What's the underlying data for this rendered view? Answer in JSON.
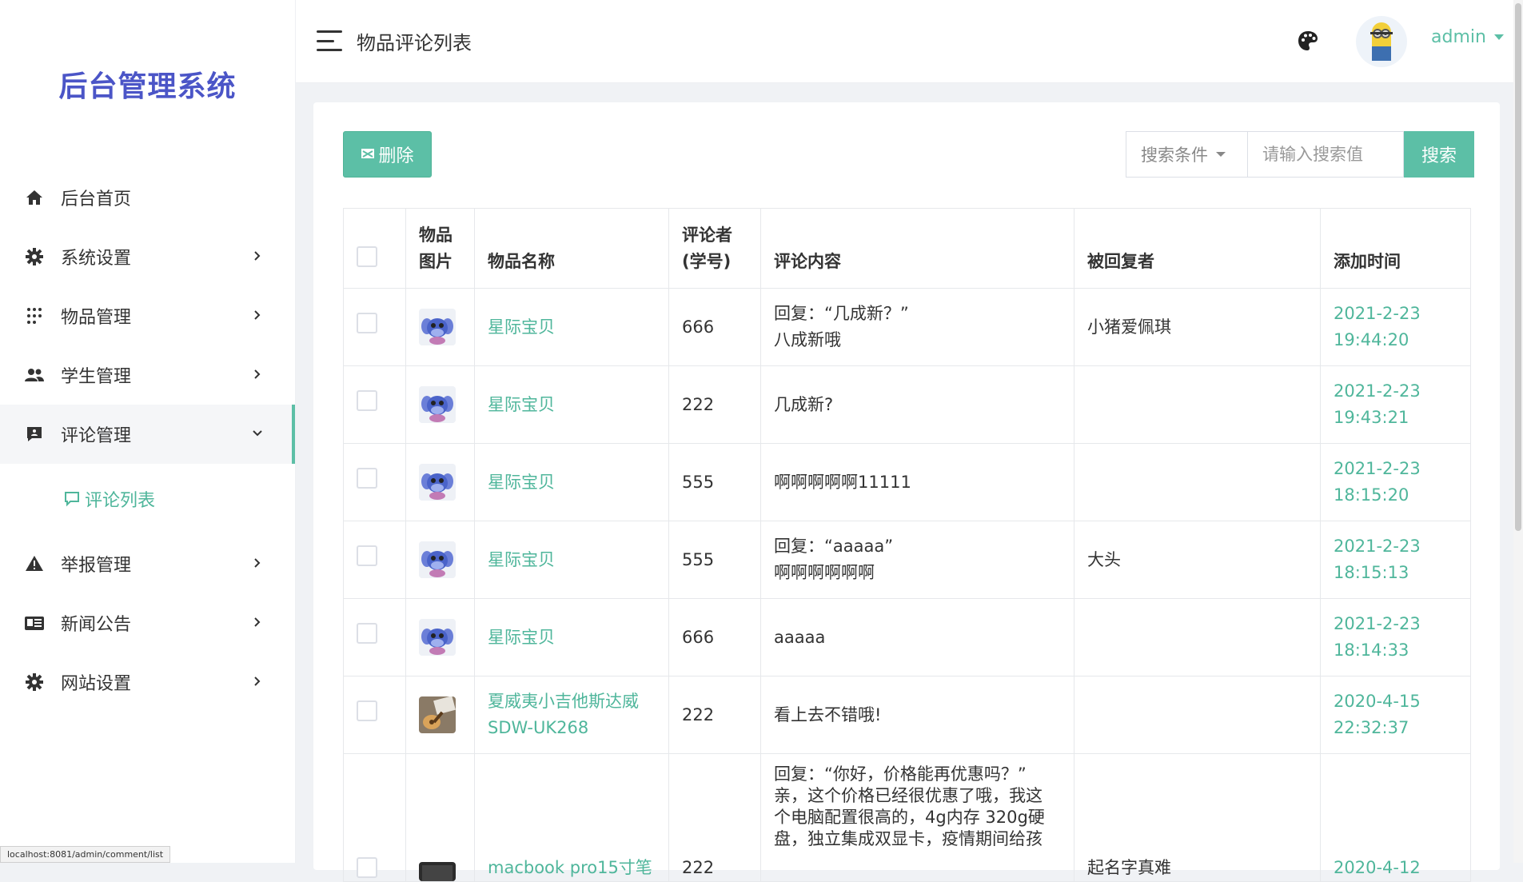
{
  "sidebar": {
    "logo": "后台管理系统",
    "items": [
      {
        "label": "后台首页",
        "icon": "home-icon"
      },
      {
        "label": "系统设置",
        "icon": "gear-icon"
      },
      {
        "label": "物品管理",
        "icon": "grid-dots-icon"
      },
      {
        "label": "学生管理",
        "icon": "users-icon"
      },
      {
        "label": "评论管理",
        "icon": "comment-icon"
      },
      {
        "label": "举报管理",
        "icon": "warning-icon"
      },
      {
        "label": "新闻公告",
        "icon": "news-icon"
      },
      {
        "label": "网站设置",
        "icon": "gear-icon"
      }
    ],
    "submenu": {
      "label": "评论列表",
      "icon": "chat-icon"
    }
  },
  "header": {
    "title": "物品评论列表",
    "username": "admin"
  },
  "toolbar": {
    "delete_label": "删除",
    "search_condition": "搜索条件",
    "search_placeholder": "请输入搜索值",
    "search_button": "搜索"
  },
  "table": {
    "headers": {
      "image_l1": "物品",
      "image_l2": "图片",
      "name": "物品名称",
      "commenter_l1": "评论者",
      "commenter_l2": "(学号)",
      "content": "评论内容",
      "replied": "被回复者",
      "time": "添加时间"
    },
    "rows": [
      {
        "name": "星际宝贝",
        "id": "666",
        "content_l1": "回复：“几成新？”",
        "content_l2": "八成新哦",
        "replied": "小猪爱佩琪",
        "date": "2021-2-23",
        "time": "19:44:20",
        "image": "stitch-toy"
      },
      {
        "name": "星际宝贝",
        "id": "222",
        "content_l1": "几成新?",
        "content_l2": "",
        "replied": "",
        "date": "2021-2-23",
        "time": "19:43:21",
        "image": "stitch-toy"
      },
      {
        "name": "星际宝贝",
        "id": "555",
        "content_l1": "啊啊啊啊啊11111",
        "content_l2": "",
        "replied": "",
        "date": "2021-2-23",
        "time": "18:15:20",
        "image": "stitch-toy"
      },
      {
        "name": "星际宝贝",
        "id": "555",
        "content_l1": "回复：“aaaaa”",
        "content_l2": "啊啊啊啊啊啊",
        "replied": "大头",
        "date": "2021-2-23",
        "time": "18:15:13",
        "image": "stitch-toy"
      },
      {
        "name": "星际宝贝",
        "id": "666",
        "content_l1": "aaaaa",
        "content_l2": "",
        "replied": "",
        "date": "2021-2-23",
        "time": "18:14:33",
        "image": "stitch-toy"
      },
      {
        "name": "夏威夷小吉他斯达威",
        "name_l2": "SDW-UK268",
        "id": "222",
        "content_l1": "看上去不错哦!",
        "content_l2": "",
        "replied": "",
        "date": "2020-4-15",
        "time": "22:32:37",
        "image": "ukulele"
      },
      {
        "name": "macbook pro15寸笔",
        "id": "222",
        "content_lines": [
          "回复：“你好，价格能再优惠吗？”",
          "亲，这个价格已经很优惠了哦，我这",
          "个电脑配置很高的，4g内存 320g硬",
          "盘，独立集成双显卡，疫情期间给孩"
        ],
        "replied": "起名字真难",
        "date": "2020-4-12",
        "image": "laptop"
      }
    ]
  },
  "status_url": "localhost:8081/admin/comment/list",
  "colors": {
    "accent": "#5cbfa6",
    "logo": "#4b55c7"
  }
}
